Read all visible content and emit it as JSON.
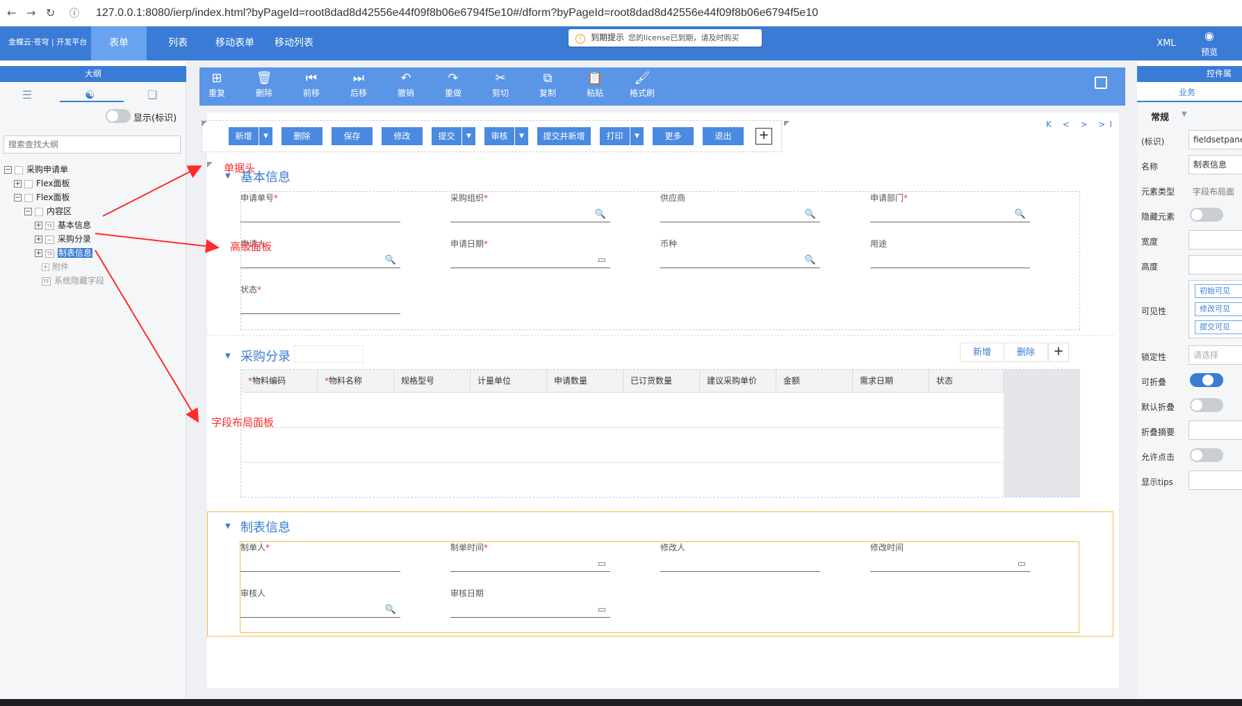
{
  "browser": {
    "url": "127.0.0.1:8080/ierp/index.html?byPageId=root8dad8d42556e44f09f8b06e6794f5e10#/dform?byPageId=root8dad8d42556e44f09f8b06e6794f5e10"
  },
  "header": {
    "logo": "金蝶云·苍穹 | 开发平台",
    "nav": [
      "表单",
      "列表",
      "移动表单",
      "移动列表"
    ],
    "notice_title": "到期提示",
    "notice_text": "您的license已到期，请及时购买",
    "xml_label": "XML",
    "preview_label": "预览"
  },
  "outline": {
    "title": "大纲",
    "show_id_label": "显示(标识)",
    "search_placeholder": "搜索查找大纲",
    "tree": [
      "采购申请单",
      "Flex面板",
      "Flex面板",
      "内容区",
      "基本信息",
      "采购分录",
      "制表信息",
      "附件",
      "系统隐藏字段"
    ]
  },
  "toolbar": {
    "items": [
      "重复",
      "删除",
      "前移",
      "后移",
      "撤销",
      "重做",
      "剪切",
      "复制",
      "粘贴",
      "格式刷"
    ]
  },
  "actions": {
    "buttons": [
      "新增",
      "删除",
      "保存",
      "修改",
      "提交",
      "审核",
      "提交并新增",
      "打印",
      "更多",
      "退出"
    ],
    "add": "+",
    "pager": "K < > >I"
  },
  "section1": {
    "title": "基本信息",
    "fields": [
      {
        "label": "申请单号",
        "req": "*"
      },
      {
        "label": "采购组织",
        "req": "*"
      },
      {
        "label": "供应商",
        "req": ""
      },
      {
        "label": "申请部门",
        "req": "*"
      },
      {
        "label": "申请人",
        "req": ""
      },
      {
        "label": "申请日期",
        "req": "*"
      },
      {
        "label": "币种",
        "req": ""
      },
      {
        "label": "用途",
        "req": ""
      },
      {
        "label": "状态",
        "req": "*"
      }
    ]
  },
  "section2": {
    "title": "采购分录",
    "add_label": "新增",
    "delete_label": "删除",
    "plus": "+",
    "columns": [
      {
        "label": "物料编码",
        "req": "*"
      },
      {
        "label": "物料名称",
        "req": "*"
      },
      {
        "label": "规格型号",
        "req": ""
      },
      {
        "label": "计量单位",
        "req": ""
      },
      {
        "label": "申请数量",
        "req": ""
      },
      {
        "label": "已订货数量",
        "req": ""
      },
      {
        "label": "建议采购单价",
        "req": ""
      },
      {
        "label": "金额",
        "req": ""
      },
      {
        "label": "需求日期",
        "req": ""
      },
      {
        "label": "状态",
        "req": ""
      }
    ]
  },
  "section3": {
    "title": "制表信息",
    "fields": [
      {
        "label": "制单人",
        "req": "*"
      },
      {
        "label": "制单时间",
        "req": "*"
      },
      {
        "label": "修改人",
        "req": ""
      },
      {
        "label": "修改时间",
        "req": ""
      },
      {
        "label": "审核人",
        "req": ""
      },
      {
        "label": "审核日期",
        "req": ""
      }
    ]
  },
  "annotations": {
    "header": "单据头",
    "advanced_panel": "高级面板",
    "field_layout": "字段布局面板"
  },
  "props": {
    "title": "控件属",
    "tab": "业务",
    "group": "常规",
    "rows": {
      "id_label": "(标识)",
      "id_value": "fieldsetpane",
      "name_label": "名称",
      "name_value": "制表信息",
      "type_label": "元素类型",
      "type_value": "字段布局面",
      "hidden_label": "隐藏元素",
      "width_label": "宽度",
      "height_label": "高度",
      "visibility_label": "可见性",
      "vis_tags": [
        "初始可见",
        "修改可见",
        "提交可见"
      ],
      "lock_label": "锁定性",
      "lock_placeholder": "请选择",
      "collapsible_label": "可折叠",
      "default_collapse_label": "默认折叠",
      "collapse_summary_label": "折叠摘要",
      "allow_click_label": "允许点击",
      "tips_label": "显示tips"
    }
  },
  "colors": {
    "primary": "#3a7bd5",
    "annotation": "#ff2a2a",
    "selected_border": "#f0c040"
  }
}
